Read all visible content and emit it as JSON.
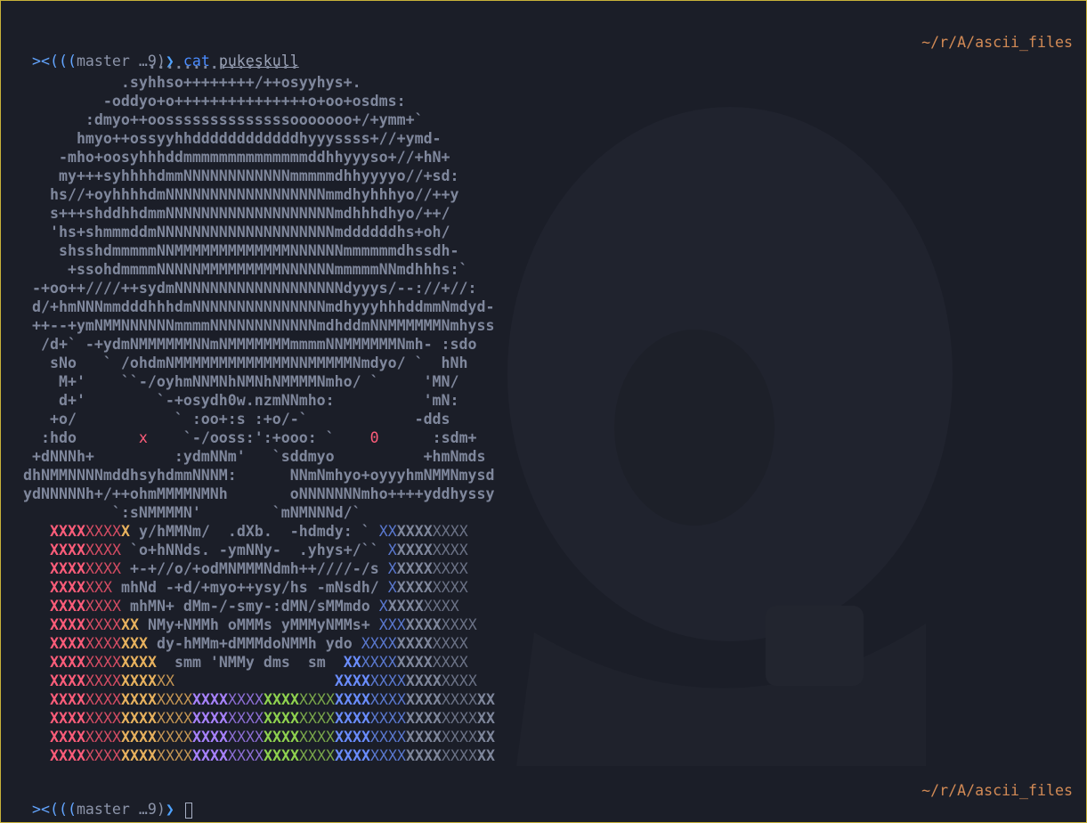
{
  "terminal": {
    "prompt": {
      "arrow": "><(((",
      "branch": "master …9)",
      "chevron": "❯"
    },
    "command": {
      "name": "cat",
      "arg": "pukeskull"
    },
    "right_prompt": "~/r/A/ascii_files",
    "colors": {
      "background": "#1b1e28",
      "frame": "#c8b23a",
      "art_text": "#7f879c",
      "red": "#ff5d7a",
      "yellow": "#e8b25e",
      "purple": "#a882ff",
      "green": "#8fd24f",
      "blue": "#6a8dff",
      "path": "#d28a55"
    }
  },
  "art_lines": [
    "              .................",
    "           .syhhso++++++++/++osyyhys+.",
    "         -oddyo+o+++++++++++++++o+oo+osdms:",
    "       :dmyo++oossssssssssssssooooooo+/+ymm+`",
    "      hmyo++ossyyhhddddddddddddhyyyssss+//+ymd-",
    "    -mho+oosyhhhddmmmmmmmmmmmmmmddhhyyyso+//+hN+",
    "    my+++syhhhhdmmNNNNNNNNNNNNmmmmmdhhyyyyo//+sd:",
    "   hs//+oyhhhhdmNNNNNNNNNNNNNNNNNNmmdhyhhhyo//++y",
    "   s+++shddhhdmmNNNNNNNNNNNNNNNNNNNmdhhhdhyo/++/",
    "   'hs+shmmmddmNNNNNNNNNNNNNNNNNNNNmddddddhs+oh/",
    "    shsshdmmmmmNNMMMMMMMMMMMMMNNNNNNmmmmmmdhssdh-",
    "     +ssohdmmmmNNNNNMMMMMMMMMNNNNNNmmmmmNNmdhhhs:`",
    " -+oo++////++sydmNNNNNNNNNNNNNNNNNNNdyyys/--://+//:",
    " d/+hmNNNmmdddhhhdmNNNNNNNNNNNNNNNmdhyyyhhhddmmNmdyd-",
    " ++--+ymNMMNNNNNNmmmmNNNNNNNNNNNNmdhddmNNMMMMMMNmhyss",
    "  /d+` -+ydmNMMMMMMNNmNMMMMMMMmmmmNNMMMMMMNmh- :sdo",
    "   sNo   ` /ohdmNMMMMMMMMMMMMMNNMMMMMNmdyo/ `  hNh",
    "    M+'    ``-/oyhmNNMNhNMNhNMMMMNmho/ `     'MN/",
    "    d+'        `-+osydh0w.nzmNNmho:          'mN:",
    "   +o/           ` :oo+:s :+o/-`            -dds",
    "  :hdo       x    `-/ooss:':+ooo: `    0      :sdm+",
    " +dNNNh+         :ydmNNm'   `sddmyo          +hmNmds",
    "dhNMMNNNNmddhsyhdmmNNNM:      NNmNmhyo+oyyyhmNMMNmysd",
    "ydNNNNNh+/++ohmMMMMNMNh       oNNNNNNNmho++++yddhyssy",
    "          `:sNMMMMN'        `mNMNNNd/`"
  ],
  "flag_rows": [
    {
      "left": "XXXXXXXXX",
      "mid": " y/hMMNm/  .dXb.  -hdmdy: ` ",
      "right": "XXXXXXXXXX"
    },
    {
      "left": "XXXXXXXX",
      "mid": " `o+hNNds. -ymNNy-  .yhys+/`` ",
      "right": "XXXXXXXXX"
    },
    {
      "left": "XXXXXXXX",
      "mid": " +-+//o/+odMNMMMNdmh++////-/s ",
      "right": "XXXXXXXXX"
    },
    {
      "left": "XXXXXXX",
      "mid": " mhNd -+d/+myo++ysy/hs -mNsdh/ ",
      "right": "XXXXXXXXX"
    },
    {
      "left": "XXXXXXXX",
      "mid": " mhMN+ dMm-/-smy-:dMN/sMMmdo ",
      "right": "XXXXXXXXX"
    },
    {
      "left": "XXXXXXXXXX",
      "mid": " NMy+NMMh oMMMs yMMMyNMMs+ ",
      "right": "XXXXXXXXXXX"
    },
    {
      "left": "XXXXXXXXXXX",
      "mid": " dy-hMMm+dMMMdoNMMh ydo ",
      "right": "XXXXXXXXXXXX"
    },
    {
      "left": "XXXXXXXXXXXX",
      "mid": "  smm 'NMMy dms  sm  ",
      "right": "XXXXXXXXXXXXXX"
    },
    {
      "left": "XXXXXXXXXXXXXX",
      "mid": "                  ",
      "right": "XXXXXXXXXXXXXXXX"
    },
    {
      "full": "XXXXXXXXXXXXXXXXXXXXXXXXXXXXXXXXXXXXXXXXXXXXXXXXXX"
    },
    {
      "full": "XXXXXXXXXXXXXXXXXXXXXXXXXXXXXXXXXXXXXXXXXXXXXXXXXX"
    },
    {
      "full": "XXXXXXXXXXXXXXXXXXXXXXXXXXXXXXXXXXXXXXXXXXXXXXXXXX"
    },
    {
      "full": "XXXXXXXXXXXXXXXXXXXXXXXXXXXXXXXXXXXXXXXXXXXXXXXXXX"
    }
  ]
}
